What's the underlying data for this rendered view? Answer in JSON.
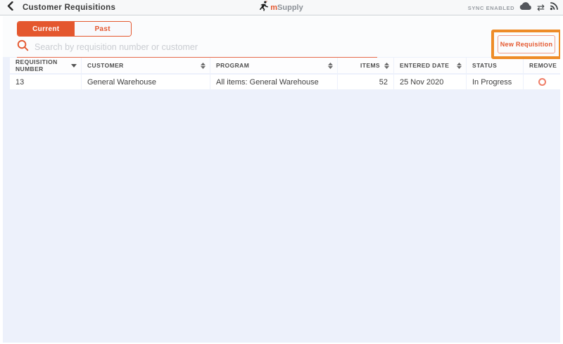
{
  "header": {
    "title": "Customer Requisitions",
    "logo": {
      "prefix": "m",
      "name": "Supply"
    },
    "sync_status": "SYNC ENABLED",
    "icons": [
      "chevron-left-icon",
      "runner-logo-icon",
      "cloud-icon",
      "sync-arrows-icon",
      "broadcast-icon"
    ]
  },
  "tabs": [
    {
      "label": "Current",
      "active": true
    },
    {
      "label": "Past",
      "active": false
    }
  ],
  "search": {
    "placeholder": "Search by requisition number or customer",
    "value": "",
    "icon": "search-icon"
  },
  "actions": {
    "new_requisition_label": "New Requisition",
    "highlighted": true
  },
  "table": {
    "columns": [
      {
        "label": "REQUISITION NUMBER",
        "sort": "desc"
      },
      {
        "label": "CUSTOMER",
        "sort": "both"
      },
      {
        "label": "PROGRAM",
        "sort": "both"
      },
      {
        "label": "ITEMS",
        "sort": "both",
        "align": "right"
      },
      {
        "label": "ENTERED DATE",
        "sort": "both"
      },
      {
        "label": "STATUS",
        "sort": "none"
      },
      {
        "label": "REMOVE",
        "sort": "none"
      }
    ],
    "rows": [
      {
        "requisition_number": "13",
        "customer": "General Warehouse",
        "program": "All items: General Warehouse",
        "items": "52",
        "entered_date": "25 Nov 2020",
        "status": "In Progress",
        "remove": "radio-circle-icon"
      }
    ]
  },
  "colors": {
    "accent_orange": "#e4572e",
    "highlight_orange": "#ee8c28",
    "button_border": "#efa08f",
    "page_blue": "#edf1fb",
    "topbar_gray": "#f7f8f9",
    "text_dark": "#3f3f3f",
    "sync_gray": "#989da3",
    "placeholder_gray": "#c9ccd1"
  }
}
